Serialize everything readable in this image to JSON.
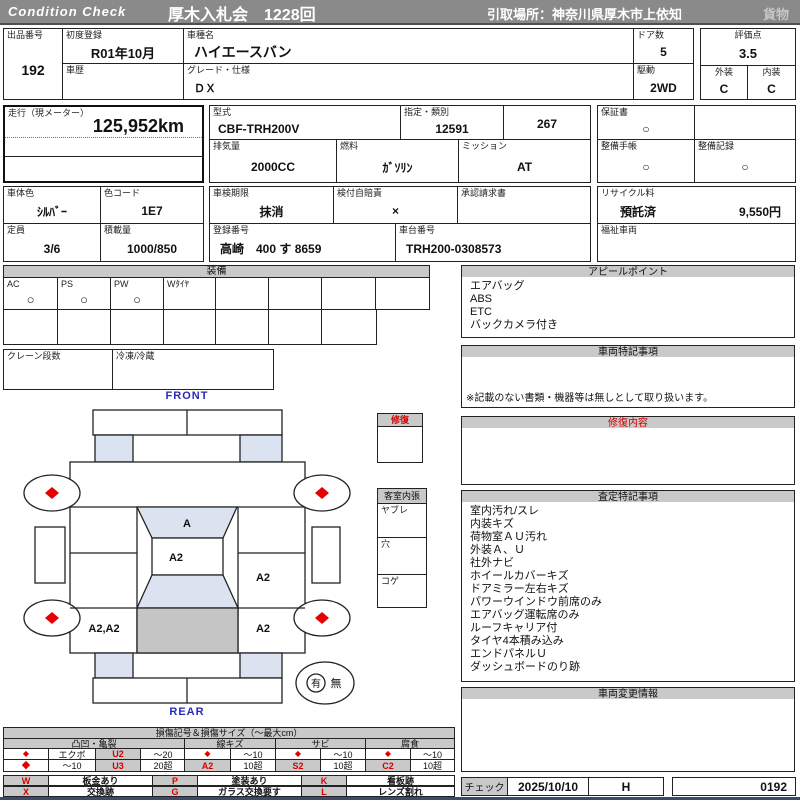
{
  "header": {
    "brand": "Condition  Check",
    "auction": "厚木入札会　1228回",
    "pickup": "引取場所：神奈川県厚木市上依知",
    "category": "貨物"
  },
  "vehicle": {
    "lot_label": "出品番号",
    "lot_no": "192",
    "first_reg_label": "初度登録",
    "first_reg": "R01年10月",
    "history_label": "車歴",
    "history": "",
    "model_label": "車種名",
    "model": "ハイエースバン",
    "grade_label": "グレード・仕様",
    "grade": "ＤＸ",
    "doors_label": "ドア数",
    "doors": "5",
    "drive_label": "駆動",
    "drive": "2WD",
    "score_label": "評価点",
    "score": "3.5",
    "ext_label": "外装",
    "ext": "C",
    "int_label": "内装",
    "int": "C",
    "mileage_label": "走行（現メーター）",
    "mileage": "125,952km",
    "type_label": "型式",
    "type": "CBF-TRH200V",
    "class_label": "指定・類別",
    "class_no1": "12591",
    "class_no2": "267",
    "warranty_label": "保証書",
    "warranty": "○",
    "disp_label": "排気量",
    "disp": "2000CC",
    "fuel_label": "燃料",
    "fuel": "ｶﾞｿﾘﾝ",
    "trans_label": "ミッション",
    "trans": "AT",
    "book_label": "整備手帳",
    "book": "○",
    "record_label": "整備記録",
    "record": "○",
    "color_label": "車体色",
    "color": "ｼﾙﾊﾞｰ",
    "color_code_label": "色コード",
    "color_code": "1E7",
    "inspection_label": "車検期限",
    "inspection": "抹消",
    "insurance_label": "検付自賠責",
    "insurance": "×",
    "approval_label": "承認請求書",
    "approval": "",
    "recycle_label": "リサイクル料",
    "recycle_status": "預託済",
    "recycle_fee": "9,550円",
    "capacity_label": "定員",
    "capacity": "3/6",
    "load_label": "積載量",
    "load": "1000/850",
    "reg_no_label": "登録番号",
    "reg_no": "高崎　400 す 8659",
    "chassis_label": "車台番号",
    "chassis": "TRH200-0308573",
    "welfare_label": "福祉車両",
    "welfare": ""
  },
  "equipment": {
    "title": "装備",
    "items": [
      {
        "label": "AC",
        "value": "○"
      },
      {
        "label": "PS",
        "value": "○"
      },
      {
        "label": "PW",
        "value": "○"
      },
      {
        "label": "Wﾀｲﾔ",
        "value": ""
      }
    ],
    "crane_label": "クレーン段数",
    "fridge_label": "冷凍/冷蔵"
  },
  "diagram": {
    "front": "FRONT",
    "rear": "REAR",
    "windshield_mark": "A",
    "roof_mark": "A2",
    "right_side_mark": "A2",
    "rear_left_mark": "A2,A2",
    "rear_right_mark": "A2",
    "repair_label": "修復",
    "interior_label": "客室内張",
    "interior_row1": "ヤブレ",
    "interior_row2": "穴",
    "interior_row3": "コゲ",
    "presence_yes": "有",
    "presence_no": "無"
  },
  "appeal": {
    "title": "アピールポイント",
    "items": [
      "エアバッグ",
      "ABS",
      "ETC",
      "バックカメラ付き"
    ]
  },
  "vehicle_notes": {
    "title": "車両特記事項",
    "note": "※記載のない書類・機器等は無しとして取り扱います。"
  },
  "repair_content": {
    "title": "修復内容"
  },
  "assessment": {
    "title": "査定特記事項",
    "items": [
      "室内汚れ/スレ",
      "内装キズ",
      "荷物室ＡＵ汚れ",
      "外装Ａ、Ｕ",
      "社外ナビ",
      "ホイールカバーキズ",
      "ドアミラー左右キズ",
      "パワーウインドウ前席のみ",
      "エアバッグ運転席のみ",
      "ルーフキャリア付",
      "タイヤ4本積み込み",
      "エンドパネルＵ",
      "ダッシュボードのり跡"
    ]
  },
  "change_info": {
    "title": "車両変更情報"
  },
  "check": {
    "label": "チェック",
    "date": "2025/10/10",
    "inspector": "H",
    "serial": "0192"
  },
  "legend": {
    "title": "損傷記号＆損傷サイズ（～最大cm）",
    "diamond": "◆",
    "cat_dent": "凸凹・亀裂",
    "cat_scratch": "線キズ",
    "cat_rust": "サビ",
    "cat_corrosion": "腐食",
    "dent_r1_label": "エクボ",
    "dent_r1_code": "U2",
    "dent_r1_size": "～20",
    "dent_r2_label": "～10",
    "dent_r2_code": "U3",
    "dent_r2_size": "20超",
    "scratch_r1_size": "～10",
    "scratch_r2_code": "A2",
    "scratch_r2_size": "10超",
    "rust_r1_size": "～10",
    "rust_r2_code": "S2",
    "rust_r2_size": "10超",
    "corr_r1_size": "～10",
    "corr_r2_code": "C2",
    "corr_r2_size": "10超"
  },
  "repair_legend": {
    "w": "W",
    "w_label": "板金あり",
    "x": "X",
    "x_label": "交換跡",
    "p": "P",
    "p_label": "塗装あり",
    "g": "G",
    "g_label": "ガラス交換要す",
    "k": "K",
    "k_label": "看板跡",
    "l": "L",
    "l_label": "レンズ割れ"
  },
  "colors": {
    "accent_red": "#d60000",
    "header_gray": "#8a8a8a",
    "cell_gray": "#c9c9c9",
    "front_rear_blue": "#2a2ab8",
    "window_shade": "#dae3ef",
    "cargo_shade": "#c5c5c5"
  }
}
